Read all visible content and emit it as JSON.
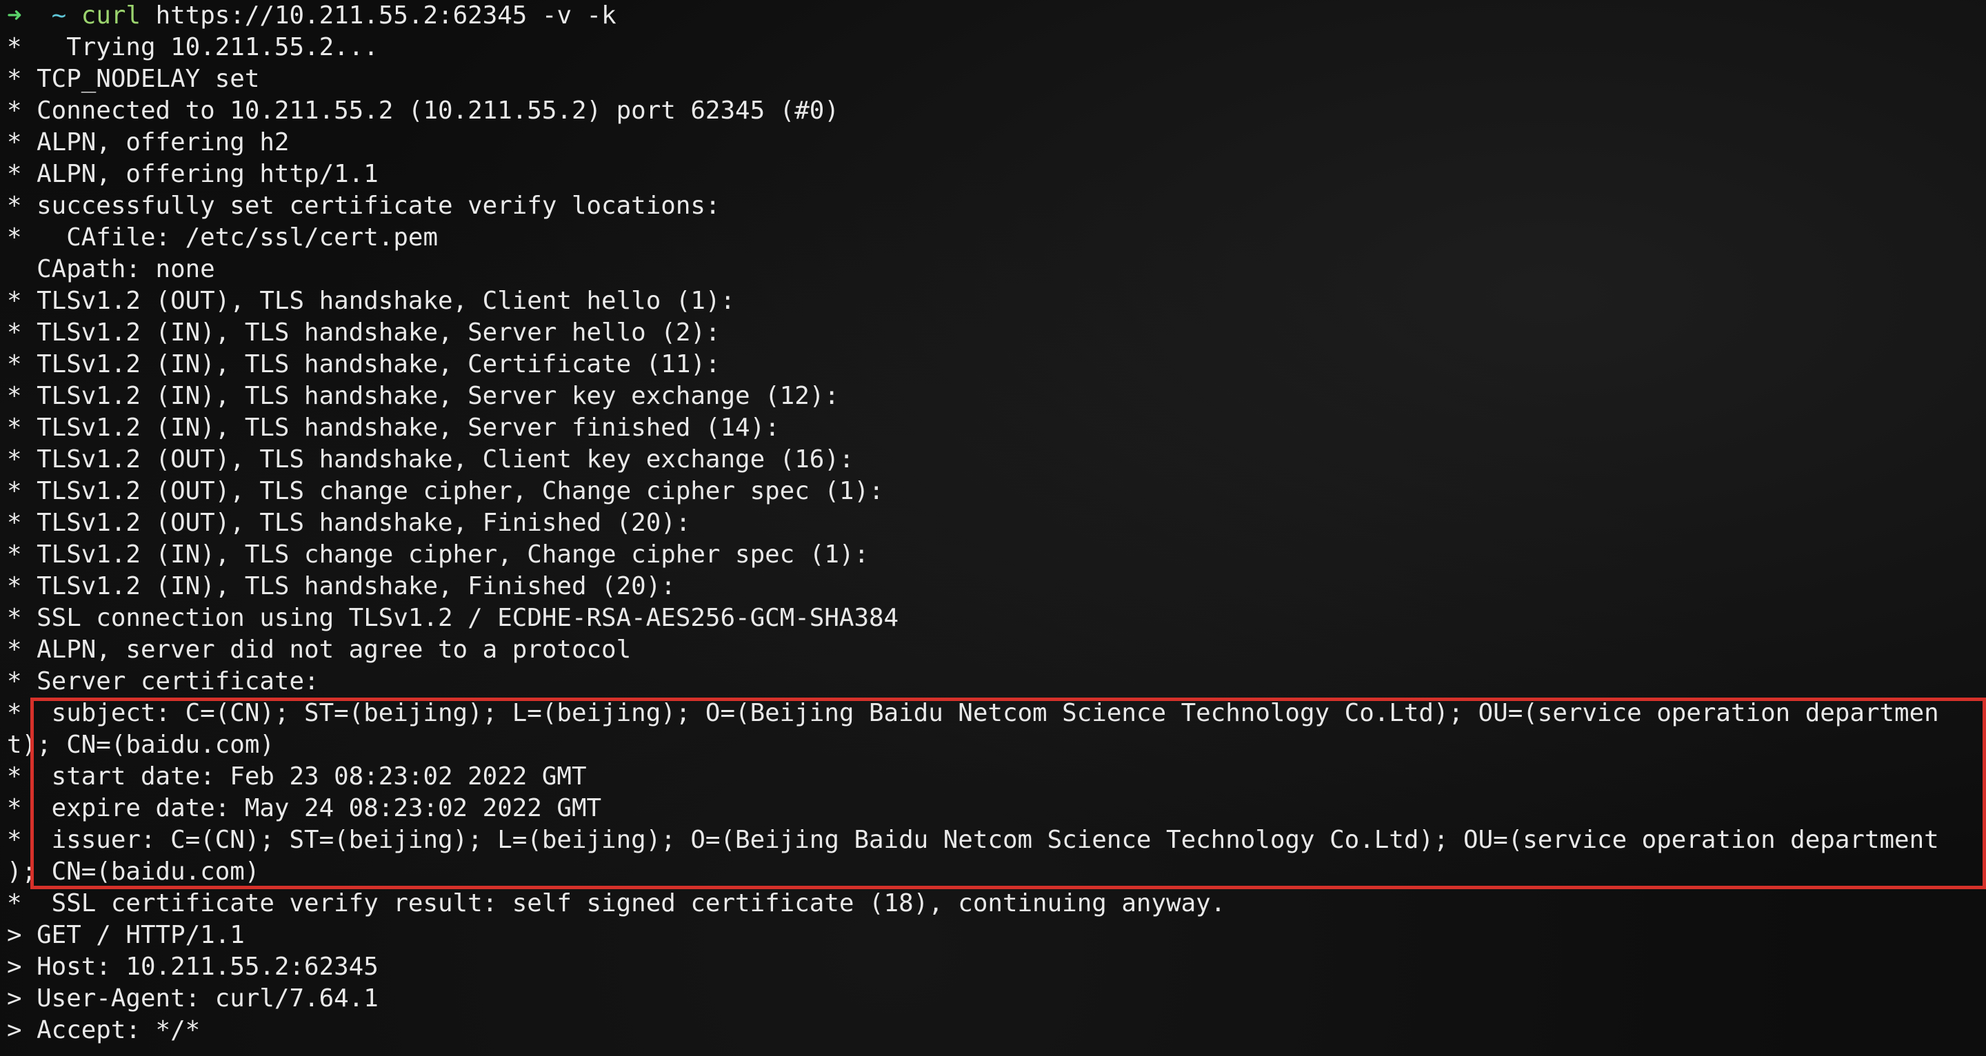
{
  "prompt": {
    "arrow": "➜",
    "cwd": "~",
    "program": "curl",
    "args": " https://10.211.55.2:62345 -v -k"
  },
  "output_lines": [
    "*   Trying 10.211.55.2...",
    "* TCP_NODELAY set",
    "* Connected to 10.211.55.2 (10.211.55.2) port 62345 (#0)",
    "* ALPN, offering h2",
    "* ALPN, offering http/1.1",
    "* successfully set certificate verify locations:",
    "*   CAfile: /etc/ssl/cert.pem",
    "  CApath: none",
    "* TLSv1.2 (OUT), TLS handshake, Client hello (1):",
    "* TLSv1.2 (IN), TLS handshake, Server hello (2):",
    "* TLSv1.2 (IN), TLS handshake, Certificate (11):",
    "* TLSv1.2 (IN), TLS handshake, Server key exchange (12):",
    "* TLSv1.2 (IN), TLS handshake, Server finished (14):",
    "* TLSv1.2 (OUT), TLS handshake, Client key exchange (16):",
    "* TLSv1.2 (OUT), TLS change cipher, Change cipher spec (1):",
    "* TLSv1.2 (OUT), TLS handshake, Finished (20):",
    "* TLSv1.2 (IN), TLS change cipher, Change cipher spec (1):",
    "* TLSv1.2 (IN), TLS handshake, Finished (20):",
    "* SSL connection using TLSv1.2 / ECDHE-RSA-AES256-GCM-SHA384",
    "* ALPN, server did not agree to a protocol",
    "* Server certificate:",
    "*  subject: C=(CN); ST=(beijing); L=(beijing); O=(Beijing Baidu Netcom Science Technology Co.Ltd); OU=(service operation departmen",
    "t); CN=(baidu.com)",
    "*  start date: Feb 23 08:23:02 2022 GMT",
    "*  expire date: May 24 08:23:02 2022 GMT",
    "*  issuer: C=(CN); ST=(beijing); L=(beijing); O=(Beijing Baidu Netcom Science Technology Co.Ltd); OU=(service operation department",
    "); CN=(baidu.com)",
    "*  SSL certificate verify result: self signed certificate (18), continuing anyway.",
    "> GET / HTTP/1.1",
    "> Host: 10.211.55.2:62345",
    "> User-Agent: curl/7.64.1",
    "> Accept: */*"
  ],
  "colors": {
    "background": "#0d0d0d",
    "text": "#e9e9e9",
    "prompt_arrow": "#5ad36a",
    "prompt_cwd": "#5fc7d8",
    "command": "#9bd46e",
    "highlight_border": "#d6312a"
  }
}
